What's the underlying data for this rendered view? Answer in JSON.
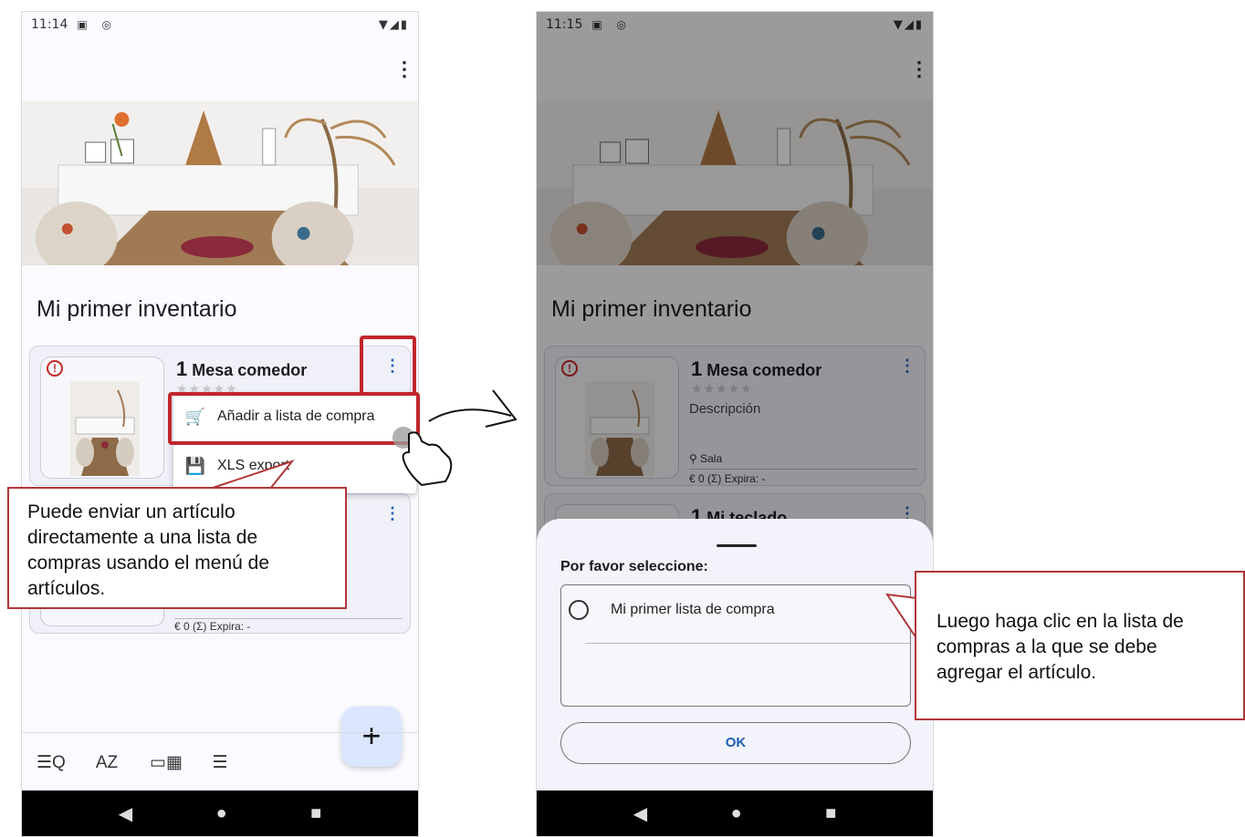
{
  "left": {
    "status_time": "11:14",
    "status_icons": "▣ ◎",
    "status_right": "▼◢▮",
    "menu_glyph": "⋮",
    "inventory_title": "Mi primer inventario",
    "card1": {
      "warn": "!",
      "qty": "1",
      "name": "Mesa comedor",
      "stars": "★★★★★",
      "kebab": "⋮"
    },
    "card2": {
      "kebab": "⋮",
      "meta": "€ 0  (Σ)   Expira: -"
    },
    "popup": [
      {
        "icon": "add-cart-icon",
        "glyph": "🛒",
        "label": "Añadir a lista de compra"
      },
      {
        "icon": "save-icon",
        "glyph": "💾",
        "label": "XLS export"
      }
    ],
    "fab": "+",
    "bottom_icons": [
      {
        "name": "filter-search-icon",
        "glyph": "☰Q"
      },
      {
        "name": "sort-az-icon",
        "glyph": "AZ"
      },
      {
        "name": "grid-view-icon",
        "glyph": "▭▦"
      },
      {
        "name": "list-view-icon",
        "glyph": "☰"
      }
    ],
    "nav": [
      "◀",
      "●",
      "■"
    ],
    "callout": "Puede enviar un artículo directamente a una lista de compras usando el menú de artículos."
  },
  "right": {
    "status_time": "11:15",
    "status_icons": "▣ ◎",
    "status_right": "▼◢▮",
    "menu_glyph": "⋮",
    "inventory_title": "Mi primer inventario",
    "card1": {
      "warn": "!",
      "qty": "1",
      "name": "Mesa comedor",
      "stars": "★★★★★",
      "description": "Descripción",
      "location": "Sala",
      "meta": "€ 0  (Σ)   Expira: -",
      "kebab": "⋮"
    },
    "card2": {
      "qty": "1",
      "name": "Mi teclado",
      "kebab": "⋮"
    },
    "sheet": {
      "title": "Por favor seleccione:",
      "list_item": "Mi primer lista de compra",
      "ok": "OK"
    },
    "nav": [
      "◀",
      "●",
      "■"
    ],
    "callout": "Luego haga clic en la lista de compras a la que se debe agregar el artículo."
  }
}
